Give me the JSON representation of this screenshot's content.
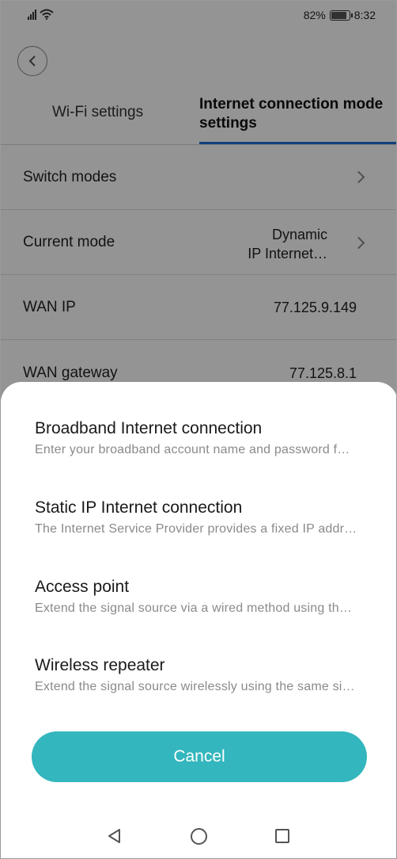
{
  "status_bar": {
    "battery_percent": "82%",
    "time": "8:32",
    "icons": [
      "signal-icon",
      "wifi-icon",
      "battery-icon"
    ]
  },
  "header": {
    "back_icon": "chevron-left-icon",
    "tabs": [
      {
        "label": "Wi-Fi settings",
        "active": false
      },
      {
        "label": "Internet connection mode settings",
        "active": true
      }
    ],
    "accent_color": "#1f6fd8"
  },
  "settings": {
    "switch_modes": {
      "label": "Switch modes"
    },
    "current_mode": {
      "label": "Current mode",
      "value_line1": "Dynamic",
      "value_line2": "IP Internet…"
    },
    "wan_ip": {
      "label": "WAN IP",
      "value": "77.125.9.149"
    },
    "wan_gateway": {
      "label": "WAN gateway",
      "value": "77.125.8.1"
    }
  },
  "sheet": {
    "options": [
      {
        "title": "Broadband Internet connection",
        "desc": "Enter your broadband account name and password f…"
      },
      {
        "title": "Static IP Internet connection",
        "desc": "The Internet Service Provider provides a fixed IP addr…"
      },
      {
        "title": "Access point",
        "desc": "Extend the signal source via a wired method using th…"
      },
      {
        "title": "Wireless repeater",
        "desc": "Extend the signal source wirelessly using the same si…"
      }
    ],
    "cancel_label": "Cancel",
    "cancel_color": "#33b6bd"
  },
  "nav_bar": {
    "icons": [
      "back-triangle-icon",
      "home-circle-icon",
      "recent-square-icon"
    ]
  }
}
